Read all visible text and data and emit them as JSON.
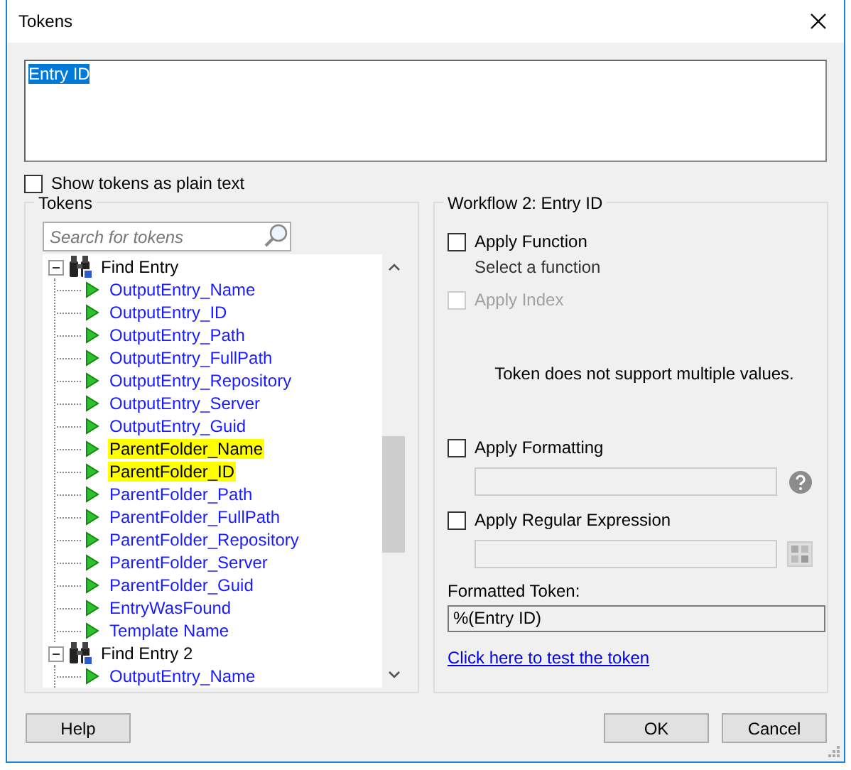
{
  "window": {
    "title": "Tokens"
  },
  "expression": {
    "value": "Entry ID",
    "selected": true
  },
  "show_plain_text": {
    "label": "Show tokens as plain text",
    "checked": false
  },
  "tokens_panel": {
    "title": "Tokens",
    "search": {
      "placeholder": "Search for tokens"
    },
    "tree": [
      {
        "label": "Find Entry",
        "kind": "activity",
        "expanded": true,
        "children": [
          {
            "label": "OutputEntry_Name",
            "kind": "token",
            "highlighted": false
          },
          {
            "label": "OutputEntry_ID",
            "kind": "token",
            "highlighted": false
          },
          {
            "label": "OutputEntry_Path",
            "kind": "token",
            "highlighted": false
          },
          {
            "label": "OutputEntry_FullPath",
            "kind": "token",
            "highlighted": false
          },
          {
            "label": "OutputEntry_Repository",
            "kind": "token",
            "highlighted": false
          },
          {
            "label": "OutputEntry_Server",
            "kind": "token",
            "highlighted": false
          },
          {
            "label": "OutputEntry_Guid",
            "kind": "token",
            "highlighted": false
          },
          {
            "label": "ParentFolder_Name",
            "kind": "token",
            "highlighted": true
          },
          {
            "label": "ParentFolder_ID",
            "kind": "token",
            "highlighted": true
          },
          {
            "label": "ParentFolder_Path",
            "kind": "token",
            "highlighted": false
          },
          {
            "label": "ParentFolder_FullPath",
            "kind": "token",
            "highlighted": false
          },
          {
            "label": "ParentFolder_Repository",
            "kind": "token",
            "highlighted": false
          },
          {
            "label": "ParentFolder_Server",
            "kind": "token",
            "highlighted": false
          },
          {
            "label": "ParentFolder_Guid",
            "kind": "token",
            "highlighted": false
          },
          {
            "label": "EntryWasFound",
            "kind": "token",
            "highlighted": false
          },
          {
            "label": "Template Name",
            "kind": "token",
            "highlighted": false
          }
        ]
      },
      {
        "label": "Find Entry 2",
        "kind": "activity",
        "expanded": true,
        "children": [
          {
            "label": "OutputEntry_Name",
            "kind": "token",
            "highlighted": false
          }
        ]
      }
    ]
  },
  "details_panel": {
    "title": "Workflow 2: Entry ID",
    "apply_function": {
      "label": "Apply Function",
      "checked": false,
      "disabled": false
    },
    "function_hint": "Select a function",
    "apply_index": {
      "label": "Apply Index",
      "checked": false,
      "disabled": true
    },
    "message": "Token does not support multiple values.",
    "apply_formatting": {
      "label": "Apply Formatting",
      "checked": false,
      "disabled": false
    },
    "apply_regex": {
      "label": "Apply Regular Expression",
      "checked": false,
      "disabled": false
    },
    "formatted_token_label": "Formatted Token:",
    "formatted_token": {
      "value": "%(Entry ID)"
    },
    "test_link": "Click here to test the token"
  },
  "help_button": "Help",
  "buttons": [
    "OK",
    "Cancel"
  ]
}
